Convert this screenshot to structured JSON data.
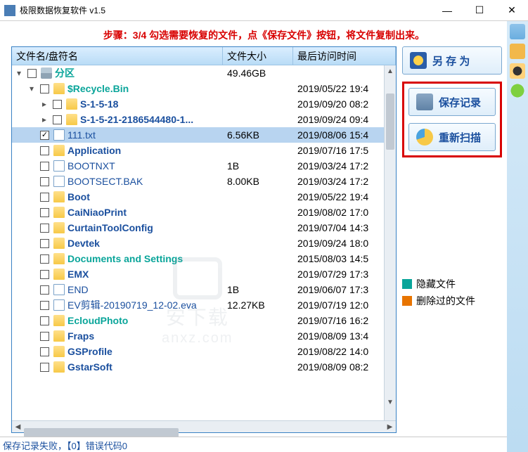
{
  "window": {
    "title": "极限数据恢复软件 v1.5",
    "min": "—",
    "max": "☐",
    "close": "✕"
  },
  "instruction": "步骤：3/4 勾选需要恢复的文件，点《保存文件》按钮，将文件复制出来。",
  "columns": {
    "name": "文件名/盘符名",
    "size": "文件大小",
    "date": "最后访问时间"
  },
  "rows": [
    {
      "indent": 0,
      "exp": "▾",
      "chk": false,
      "icon": "drive",
      "name": "分区",
      "cls": "teal-bold",
      "size": "49.46GB",
      "date": ""
    },
    {
      "indent": 1,
      "exp": "▾",
      "chk": false,
      "icon": "folder",
      "name": "$Recycle.Bin",
      "cls": "teal-bold",
      "size": "",
      "date": "2019/05/22 19:4"
    },
    {
      "indent": 2,
      "exp": "▸",
      "chk": false,
      "icon": "folder",
      "name": "S-1-5-18",
      "cls": "blue-bold",
      "size": "",
      "date": "2019/09/20 08:2"
    },
    {
      "indent": 2,
      "exp": "▸",
      "chk": false,
      "icon": "folder",
      "name": "S-1-5-21-2186544480-1...",
      "cls": "blue-bold",
      "size": "",
      "date": "2019/09/24 09:4"
    },
    {
      "indent": 1,
      "exp": "none",
      "chk": true,
      "icon": "file",
      "name": "111.txt",
      "cls": "blue",
      "size": "6.56KB",
      "date": "2019/08/06 15:4",
      "selected": true
    },
    {
      "indent": 1,
      "exp": "none",
      "chk": false,
      "icon": "folder",
      "name": "Application",
      "cls": "blue-bold",
      "size": "",
      "date": "2019/07/16 17:5"
    },
    {
      "indent": 1,
      "exp": "none",
      "chk": false,
      "icon": "file",
      "name": "BOOTNXT",
      "cls": "blue",
      "size": "1B",
      "date": "2019/03/24 17:2"
    },
    {
      "indent": 1,
      "exp": "none",
      "chk": false,
      "icon": "file",
      "name": "BOOTSECT.BAK",
      "cls": "blue",
      "size": "8.00KB",
      "date": "2019/03/24 17:2"
    },
    {
      "indent": 1,
      "exp": "none",
      "chk": false,
      "icon": "folder",
      "name": "Boot",
      "cls": "blue-bold",
      "size": "",
      "date": "2019/05/22 19:4"
    },
    {
      "indent": 1,
      "exp": "none",
      "chk": false,
      "icon": "folder",
      "name": "CaiNiaoPrint",
      "cls": "blue-bold",
      "size": "",
      "date": "2019/08/02 17:0"
    },
    {
      "indent": 1,
      "exp": "none",
      "chk": false,
      "icon": "folder",
      "name": "CurtainToolConfig",
      "cls": "blue-bold",
      "size": "",
      "date": "2019/07/04 14:3"
    },
    {
      "indent": 1,
      "exp": "none",
      "chk": false,
      "icon": "folder",
      "name": "Devtek",
      "cls": "blue-bold",
      "size": "",
      "date": "2019/09/24 18:0"
    },
    {
      "indent": 1,
      "exp": "none",
      "chk": false,
      "icon": "folder",
      "name": "Documents and Settings",
      "cls": "teal-bold",
      "size": "",
      "date": "2015/08/03 14:5"
    },
    {
      "indent": 1,
      "exp": "none",
      "chk": false,
      "icon": "folder",
      "name": "EMX",
      "cls": "blue-bold",
      "size": "",
      "date": "2019/07/29 17:3"
    },
    {
      "indent": 1,
      "exp": "none",
      "chk": false,
      "icon": "file",
      "name": "END",
      "cls": "blue",
      "size": "1B",
      "date": "2019/06/07 17:3"
    },
    {
      "indent": 1,
      "exp": "none",
      "chk": false,
      "icon": "file",
      "name": "EV剪辑-20190719_12-02.eva",
      "cls": "blue",
      "size": "12.27KB",
      "date": "2019/07/19 12:0"
    },
    {
      "indent": 1,
      "exp": "none",
      "chk": false,
      "icon": "folder",
      "name": "EcloudPhoto",
      "cls": "teal-bold",
      "size": "",
      "date": "2019/07/16 16:2"
    },
    {
      "indent": 1,
      "exp": "none",
      "chk": false,
      "icon": "folder",
      "name": "Fraps",
      "cls": "blue-bold",
      "size": "",
      "date": "2019/08/09 13:4"
    },
    {
      "indent": 1,
      "exp": "none",
      "chk": false,
      "icon": "folder",
      "name": "GSProfile",
      "cls": "blue-bold",
      "size": "",
      "date": "2019/08/22 14:0"
    },
    {
      "indent": 1,
      "exp": "none",
      "chk": false,
      "icon": "folder",
      "name": "GstarSoft",
      "cls": "blue-bold",
      "size": "",
      "date": "2019/08/09 08:2"
    }
  ],
  "buttons": {
    "save_as": "另 存 为",
    "save_record": "保存记录",
    "rescan": "重新扫描"
  },
  "legend": {
    "hidden": "隐藏文件",
    "deleted": "删除过的文件"
  },
  "status": "保存记录失败，【0】错误代码0",
  "watermark": {
    "t1": "安下载",
    "t2": "anxz.com"
  }
}
